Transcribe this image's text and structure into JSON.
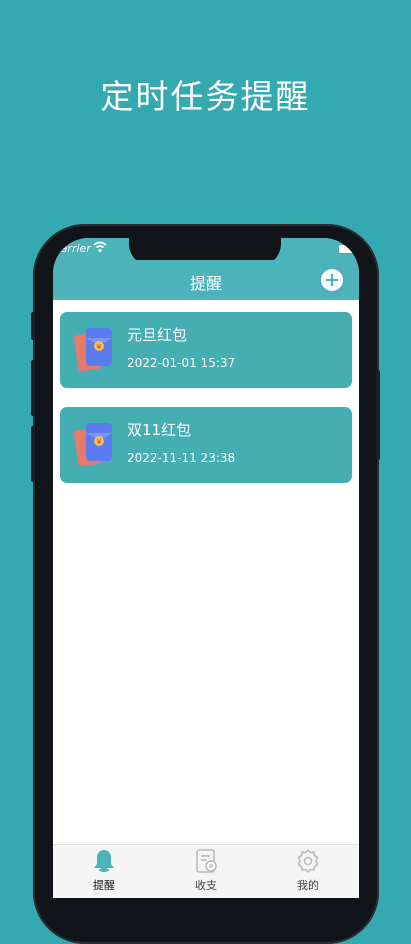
{
  "promo": {
    "title": "定时任务提醒"
  },
  "status_bar": {
    "carrier": "Carrier"
  },
  "navbar": {
    "title": "提醒",
    "add_icon": "plus-circle-icon"
  },
  "reminders": [
    {
      "title": "元旦红包",
      "time": "2022-01-01 15:37",
      "icon": "red-envelope-icon"
    },
    {
      "title": "双11红包",
      "time": "2022-11-11 23:38",
      "icon": "red-envelope-icon"
    }
  ],
  "tabs": [
    {
      "label": "提醒",
      "icon": "bell-icon",
      "active": true
    },
    {
      "label": "收支",
      "icon": "ledger-icon",
      "active": false
    },
    {
      "label": "我的",
      "icon": "gear-icon",
      "active": false
    }
  ],
  "colors": {
    "background": "#35a9b0",
    "accent": "#4bb3b9",
    "card": "#44aeb3"
  }
}
